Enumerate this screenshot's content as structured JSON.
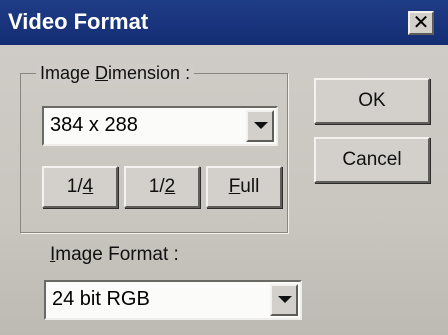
{
  "window": {
    "title": "Video Format",
    "close_glyph": "✕"
  },
  "dimension_group": {
    "label_pre": "Image ",
    "label_accel": "D",
    "label_post": "imension :",
    "combo_value": "384 x 288",
    "buttons": {
      "quarter": {
        "pre": "1/",
        "accel": "4",
        "post": ""
      },
      "half": {
        "pre": "1/",
        "accel": "2",
        "post": ""
      },
      "full": {
        "pre": "",
        "accel": "F",
        "post": "ull"
      }
    }
  },
  "format": {
    "label_pre": "",
    "label_accel": "I",
    "label_post": "mage Format :",
    "combo_value": "24 bit RGB"
  },
  "actions": {
    "ok_label": "OK",
    "cancel_label": "Cancel"
  },
  "icons": {
    "close": "close-icon",
    "dropdown": "chevron-down-icon"
  }
}
